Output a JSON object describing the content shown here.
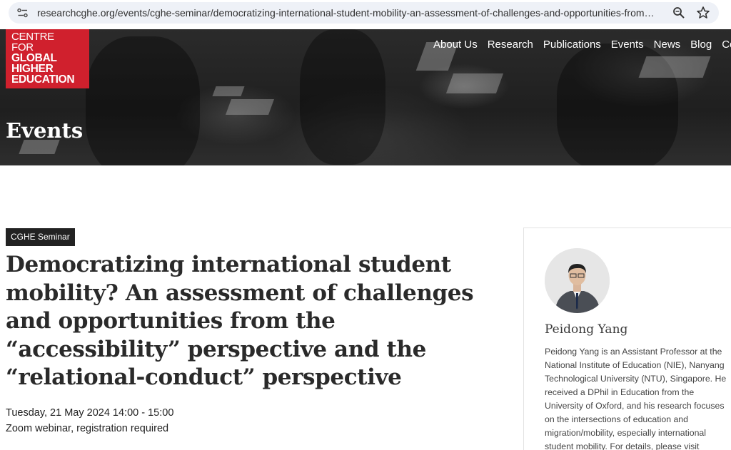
{
  "browser": {
    "url": "researchcghe.org/events/cghe-seminar/democratizing-international-student-mobility-an-assessment-of-challenges-and-opportunities-from…",
    "icons": [
      "site-info-icon",
      "zoom-icon",
      "bookmark-star-icon"
    ]
  },
  "header": {
    "logo": {
      "line1": "CENTRE",
      "line2": "FOR",
      "line3": "GLOBAL",
      "line4": "HIGHER",
      "line5": "EDUCATION",
      "color": "#d0202d"
    },
    "nav": [
      "About Us",
      "Research",
      "Publications",
      "Events",
      "News",
      "Blog",
      "Cor"
    ]
  },
  "hero": {
    "title": "Events"
  },
  "event": {
    "category": "CGHE Seminar",
    "title": "Democratizing international student mobility? An assessment of challenges and opportunities from the “accessibility” perspective and the “relational-conduct” perspective",
    "datetime": "Tuesday, 21 May 2024 14:00 - 15:00",
    "location": "Zoom webinar, registration required"
  },
  "speaker": {
    "name": "Peidong Yang",
    "bio": "Peidong Yang is an Assistant Professor at the National Institute of Education (NIE), Nanyang Technological University (NTU), Singapore. He received a DPhil in Education from the University of Oxford, and his research focuses on the intersections of education and migration/mobility, especially international student mobility. For details, please visit"
  }
}
